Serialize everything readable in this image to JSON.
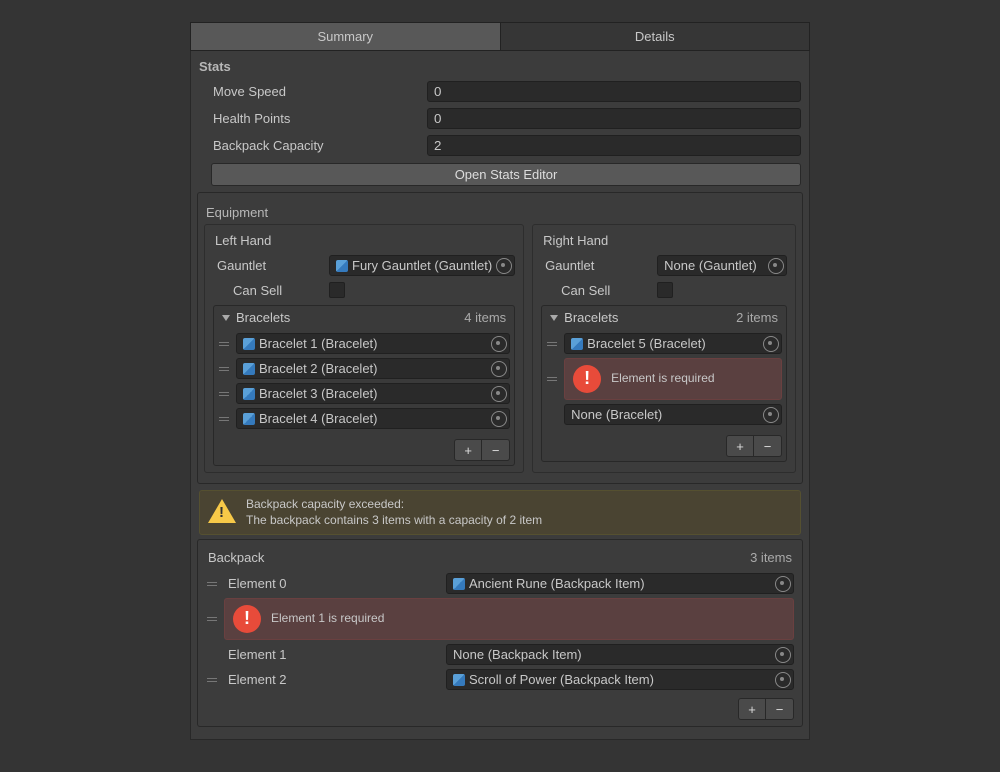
{
  "tabs": {
    "summary": "Summary",
    "details": "Details"
  },
  "stats": {
    "title": "Stats",
    "moveSpeed": {
      "label": "Move Speed",
      "value": "0"
    },
    "healthPoints": {
      "label": "Health Points",
      "value": "0"
    },
    "backpackCapacity": {
      "label": "Backpack Capacity",
      "value": "2"
    },
    "openEditor": "Open Stats Editor"
  },
  "equipment": {
    "title": "Equipment",
    "left": {
      "title": "Left Hand",
      "gauntletLabel": "Gauntlet",
      "gauntletValue": "Fury Gauntlet (Gauntlet)",
      "canSellLabel": "Can Sell",
      "bracelets": {
        "title": "Bracelets",
        "count": "4 items",
        "items": [
          "Bracelet 1 (Bracelet)",
          "Bracelet 2 (Bracelet)",
          "Bracelet 3 (Bracelet)",
          "Bracelet 4 (Bracelet)"
        ]
      }
    },
    "right": {
      "title": "Right Hand",
      "gauntletLabel": "Gauntlet",
      "gauntletValue": "None (Gauntlet)",
      "canSellLabel": "Can Sell",
      "bracelets": {
        "title": "Bracelets",
        "count": "2 items",
        "items": [
          "Bracelet 5 (Bracelet)"
        ],
        "error": "Element is required",
        "none": "None (Bracelet)"
      }
    }
  },
  "warning": {
    "line1": "Backpack capacity exceeded:",
    "line2": "The backpack contains 3 items with a capacity of 2 item"
  },
  "backpack": {
    "title": "Backpack",
    "count": "3 items",
    "el0Label": "Element 0",
    "el0Value": "Ancient Rune (Backpack Item)",
    "error": "Element 1 is required",
    "el1Label": "Element 1",
    "el1Value": "None (Backpack Item)",
    "el2Label": "Element 2",
    "el2Value": "Scroll of Power (Backpack Item)"
  },
  "glyph": {
    "plus": "+",
    "minus": "−"
  }
}
